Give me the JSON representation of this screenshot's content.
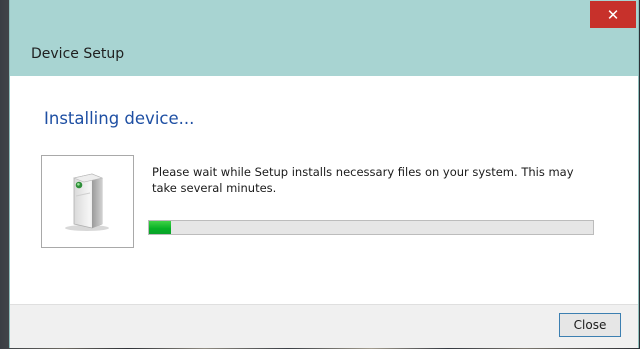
{
  "window": {
    "title": "Device Setup",
    "close_glyph": "✕"
  },
  "main": {
    "heading": "Installing device...",
    "message": "Please wait while Setup installs necessary files on your system. This may take several minutes.",
    "device_icon": "device-tower-icon"
  },
  "progress": {
    "fraction": 0.05,
    "fill_color": "#06b025"
  },
  "footer": {
    "close_label": "Close"
  },
  "colors": {
    "titlebar": "#a8d4d2",
    "heading": "#1e4fa3",
    "close_red": "#c7312b"
  }
}
